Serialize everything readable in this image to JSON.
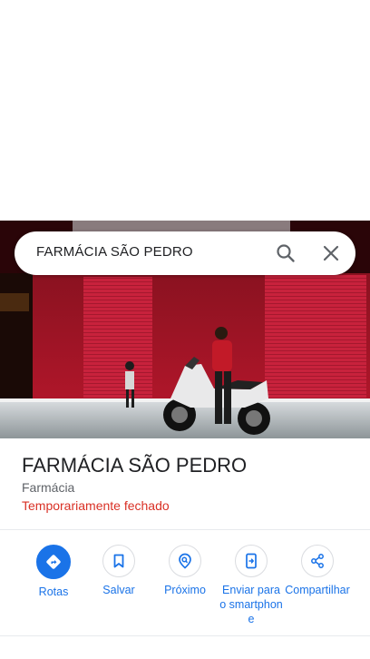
{
  "search": {
    "query": "FARMÁCIA SÃO PEDRO",
    "search_icon": "search-icon",
    "close_icon": "close-icon"
  },
  "place": {
    "name": "FARMÁCIA SÃO PEDRO",
    "category": "Farmácia",
    "status": "Temporariamente fechado",
    "status_color": "#d93025"
  },
  "actions": [
    {
      "label": "Rotas",
      "icon": "directions-icon"
    },
    {
      "label": "Salvar",
      "icon": "bookmark-icon"
    },
    {
      "label": "Próximo",
      "icon": "nearby-icon"
    },
    {
      "label": "Enviar para o smartphone",
      "icon": "send-to-phone-icon"
    },
    {
      "label": "Compartilhar",
      "icon": "share-icon"
    }
  ],
  "colors": {
    "accent": "#1a73e8",
    "text_primary": "#202124",
    "text_secondary": "#5f6368"
  }
}
